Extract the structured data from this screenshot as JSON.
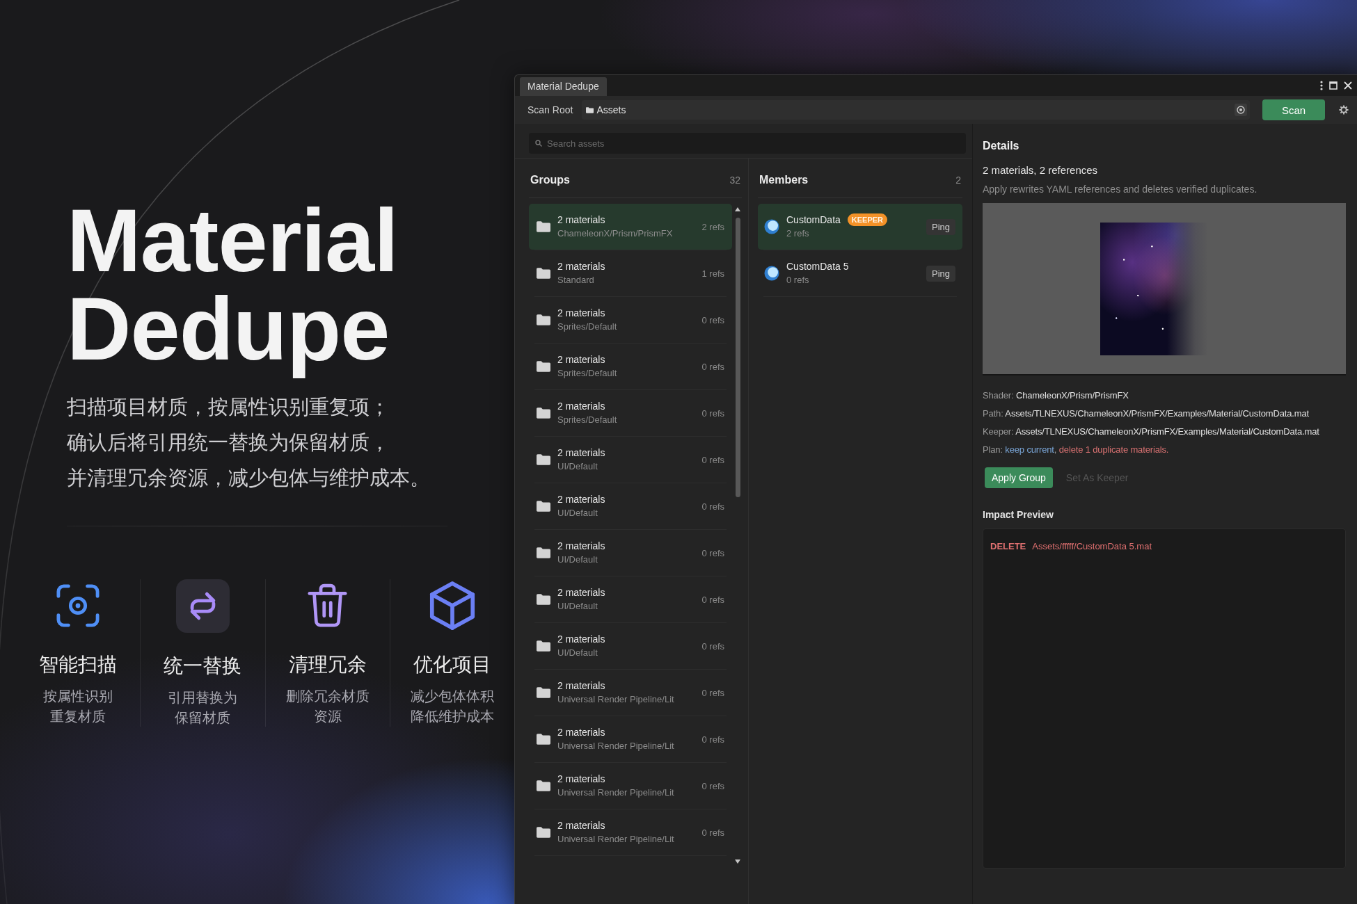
{
  "hero": {
    "title_lines": [
      "Material",
      "Dedupe"
    ],
    "description": [
      "扫描项目材质，按属性识别重复项；",
      "确认后将引用统一替换为保留材质，",
      "并清理冗余资源，减少包体与维护成本。"
    ]
  },
  "features": [
    {
      "kind": "scan",
      "title": "智能扫描",
      "description": [
        "按属性识别",
        "重复材质"
      ]
    },
    {
      "kind": "replace",
      "title": "统一替换",
      "description": [
        "引用替换为",
        "保留材质"
      ]
    },
    {
      "kind": "clean",
      "title": "清理冗余",
      "description": [
        "删除冗余材质",
        "资源"
      ]
    },
    {
      "kind": "optimize",
      "title": "优化项目",
      "description": [
        "减少包体体积",
        "降低维护成本"
      ]
    }
  ],
  "window": {
    "title": "Material Dedupe"
  },
  "toolbar": {
    "label": "Scan Root",
    "root": "Assets",
    "scan_button": "Scan"
  },
  "search": {
    "placeholder": "Search assets"
  },
  "groups": {
    "title": "Groups",
    "count": "32",
    "items": [
      {
        "title": "2 materials",
        "shader": "ChameleonX/Prism/PrismFX",
        "refs": "2 refs",
        "selected": true
      },
      {
        "title": "2 materials",
        "shader": "Standard",
        "refs": "1 refs",
        "selected": false
      },
      {
        "title": "2 materials",
        "shader": "Sprites/Default",
        "refs": "0 refs",
        "selected": false
      },
      {
        "title": "2 materials",
        "shader": "Sprites/Default",
        "refs": "0 refs",
        "selected": false
      },
      {
        "title": "2 materials",
        "shader": "Sprites/Default",
        "refs": "0 refs",
        "selected": false
      },
      {
        "title": "2 materials",
        "shader": "UI/Default",
        "refs": "0 refs",
        "selected": false
      },
      {
        "title": "2 materials",
        "shader": "UI/Default",
        "refs": "0 refs",
        "selected": false
      },
      {
        "title": "2 materials",
        "shader": "UI/Default",
        "refs": "0 refs",
        "selected": false
      },
      {
        "title": "2 materials",
        "shader": "UI/Default",
        "refs": "0 refs",
        "selected": false
      },
      {
        "title": "2 materials",
        "shader": "UI/Default",
        "refs": "0 refs",
        "selected": false
      },
      {
        "title": "2 materials",
        "shader": "Universal Render Pipeline/Lit",
        "refs": "0 refs",
        "selected": false
      },
      {
        "title": "2 materials",
        "shader": "Universal Render Pipeline/Lit",
        "refs": "0 refs",
        "selected": false
      },
      {
        "title": "2 materials",
        "shader": "Universal Render Pipeline/Lit",
        "refs": "0 refs",
        "selected": false
      },
      {
        "title": "2 materials",
        "shader": "Universal Render Pipeline/Lit",
        "refs": "0 refs",
        "selected": false
      }
    ]
  },
  "members": {
    "title": "Members",
    "count": "2",
    "items": [
      {
        "name": "CustomData",
        "badge": "KEEPER",
        "refs": "2 refs",
        "action": "Ping",
        "selected": true
      },
      {
        "name": "CustomData 5",
        "refs": "0 refs",
        "action": "Ping",
        "selected": false
      }
    ]
  },
  "details": {
    "title": "Details",
    "summary": "2 materials, 2 references",
    "note": "Apply rewrites YAML references and deletes verified duplicates.",
    "fields": [
      {
        "label": "Shader:",
        "value": "ChameleonX/Prism/PrismFX"
      },
      {
        "label": "Path:",
        "value": "Assets/TLNEXUS/ChameleonX/PrismFX/Examples/Material/CustomData.mat"
      },
      {
        "label": "Keeper:",
        "value": "Assets/TLNEXUS/ChameleonX/PrismFX/Examples/Material/CustomData.mat"
      }
    ],
    "plan": {
      "label": "Plan:",
      "parts": [
        {
          "kind": "keep",
          "text": "keep current"
        },
        {
          "kind": "plain",
          "text": ", "
        },
        {
          "kind": "delete",
          "text": "delete 1 duplicate materials."
        }
      ]
    },
    "buttons": [
      {
        "label": "Apply Group",
        "kind": "primary",
        "disabled": false
      },
      {
        "label": "Set As Keeper",
        "kind": "secondary",
        "disabled": true
      }
    ]
  },
  "impact": {
    "title": "Impact Preview",
    "entries": [
      {
        "kind": "delete",
        "action": "DELETE",
        "path": "Assets/fffff/CustomData 5.mat"
      }
    ]
  }
}
